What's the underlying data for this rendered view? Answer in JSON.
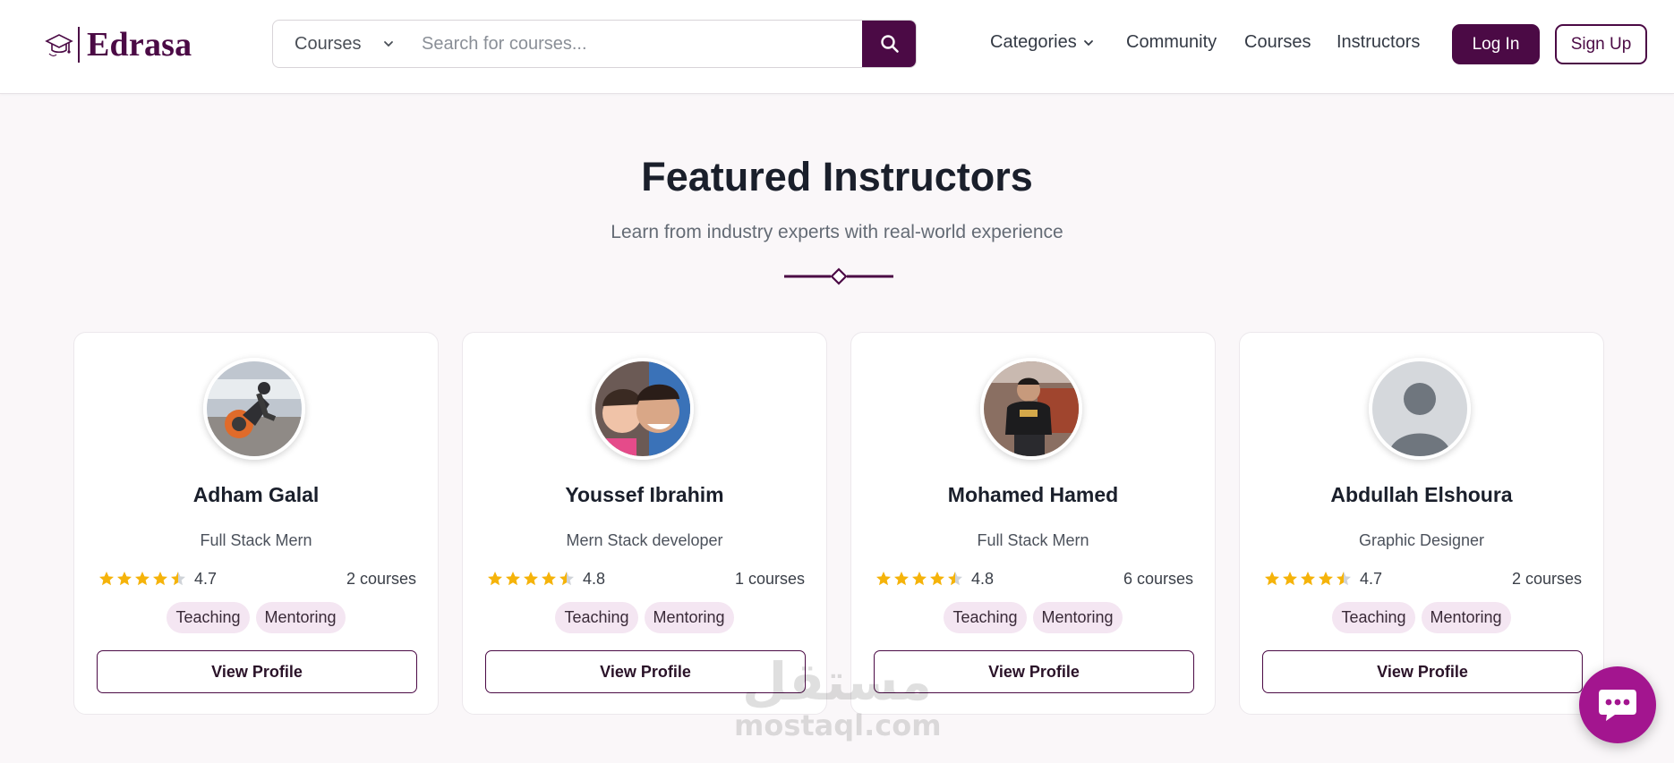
{
  "header": {
    "logo_text": "Edrasa",
    "search": {
      "category_label": "Courses",
      "placeholder": "Search for courses..."
    },
    "nav": {
      "categories": "Categories",
      "community": "Community",
      "courses": "Courses",
      "instructors": "Instructors"
    },
    "login_label": "Log In",
    "signup_label": "Sign Up"
  },
  "section": {
    "title": "Featured Instructors",
    "subtitle": "Learn from industry experts with real-world experience"
  },
  "instructors": [
    {
      "name": "Adham Galal",
      "role": "Full Stack Mern",
      "rating": "4.7",
      "courses": "2 courses",
      "tags": [
        "Teaching",
        "Mentoring"
      ],
      "button": "View Profile"
    },
    {
      "name": "Youssef Ibrahim",
      "role": "Mern Stack developer",
      "rating": "4.8",
      "courses": "1 courses",
      "tags": [
        "Teaching",
        "Mentoring"
      ],
      "button": "View Profile"
    },
    {
      "name": "Mohamed Hamed",
      "role": "Full Stack Mern",
      "rating": "4.8",
      "courses": "6 courses",
      "tags": [
        "Teaching",
        "Mentoring"
      ],
      "button": "View Profile"
    },
    {
      "name": "Abdullah Elshoura",
      "role": "Graphic Designer",
      "rating": "4.7",
      "courses": "2 courses",
      "tags": [
        "Teaching",
        "Mentoring"
      ],
      "button": "View Profile"
    }
  ],
  "watermark": {
    "arabic": "مستقل",
    "latin": "mostaql.com"
  },
  "colors": {
    "brand": "#4b0a45",
    "star": "#f5b30a",
    "tag_bg": "#f4e6f2",
    "chat": "#a3158f"
  },
  "icons": {
    "search": "search-icon",
    "chevron": "chevron-down-icon",
    "star": "star-icon",
    "chat": "chat-icon"
  }
}
